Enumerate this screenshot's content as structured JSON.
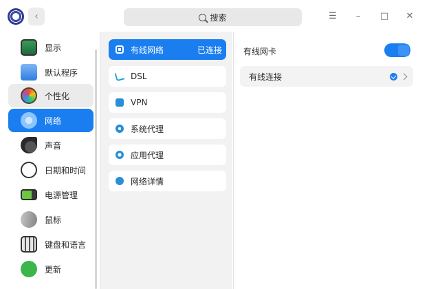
{
  "header": {
    "search_label": "搜索",
    "icons": {
      "logo": "control-center-logo",
      "back": "chevron-left-icon",
      "menu": "menu-icon",
      "minimize": "minimize-icon",
      "maximize": "maximize-icon",
      "close": "close-icon"
    },
    "window_buttons": {
      "menu": "☰",
      "minimize": "–",
      "maximize": "□",
      "close": "✕"
    },
    "back_glyph": "‹"
  },
  "sidebar": {
    "items": [
      {
        "label": "显示",
        "icon": "display-icon",
        "state": "normal"
      },
      {
        "label": "默认程序",
        "icon": "default-apps-icon",
        "state": "normal"
      },
      {
        "label": "个性化",
        "icon": "personalization-icon",
        "state": "hover"
      },
      {
        "label": "网络",
        "icon": "network-icon",
        "state": "active"
      },
      {
        "label": "声音",
        "icon": "sound-icon",
        "state": "normal"
      },
      {
        "label": "日期和时间",
        "icon": "clock-icon",
        "state": "normal"
      },
      {
        "label": "电源管理",
        "icon": "battery-icon",
        "state": "normal"
      },
      {
        "label": "鼠标",
        "icon": "mouse-icon",
        "state": "normal"
      },
      {
        "label": "键盘和语言",
        "icon": "keyboard-icon",
        "state": "normal"
      },
      {
        "label": "更新",
        "icon": "update-icon",
        "state": "normal"
      }
    ]
  },
  "network_menu": {
    "items": [
      {
        "label": "有线网络",
        "value": "已连接",
        "icon": "wired-network-icon",
        "active": true
      },
      {
        "label": "DSL",
        "value": "",
        "icon": "dsl-icon",
        "active": false
      },
      {
        "label": "VPN",
        "value": "",
        "icon": "vpn-icon",
        "active": false
      },
      {
        "label": "系统代理",
        "value": "",
        "icon": "system-proxy-icon",
        "active": false
      },
      {
        "label": "应用代理",
        "value": "",
        "icon": "app-proxy-icon",
        "active": false
      },
      {
        "label": "网络详情",
        "value": "",
        "icon": "info-icon",
        "active": false
      }
    ]
  },
  "detail": {
    "adapter_label": "有线网卡",
    "adapter_enabled": true,
    "connection_label": "有线连接",
    "connection_connected": true
  },
  "colors": {
    "accent": "#1a7ef0",
    "panel_bg": "#f2f2f2",
    "hover_bg": "#ebebeb"
  }
}
